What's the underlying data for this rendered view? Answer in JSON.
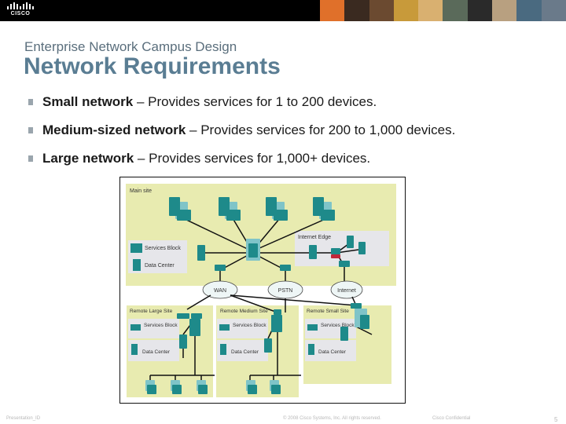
{
  "header": {
    "logo_text": "CISCO",
    "photo_strip_colors": [
      "#e0702a",
      "#3a2a20",
      "#6b4a30",
      "#c89a3a",
      "#d9b070",
      "#5a6a5a",
      "#2a2a2a",
      "#b8a080",
      "#4a6a80",
      "#6a7a8a"
    ]
  },
  "slide": {
    "subtitle": "Enterprise Network Campus Design",
    "title": "Network Requirements",
    "bullets": [
      {
        "bold": "Small network",
        "text": " – Provides services for 1 to 200 devices."
      },
      {
        "bold": "Medium-sized network",
        "text": " – Provides services for 200 to 1,000 devices."
      },
      {
        "bold": "Large network",
        "text": " – Provides services for 1,000+ devices."
      }
    ]
  },
  "diagram": {
    "main_site_label": "Main site",
    "internet_edge_label": "Internet Edge",
    "services_block_label": "Services Block",
    "data_center_label": "Data Center",
    "clouds": [
      "WAN",
      "PSTN",
      "Internet"
    ],
    "remote_large_label": "Remote Large Site",
    "remote_medium_label": "Remote Medium Site",
    "remote_small_label": "Remote Small Site",
    "services_block_short": "Services Block",
    "data_center_short": "Data Center",
    "colors": {
      "site_bg": "#e8ebb0",
      "block_bg": "#e6e6ea",
      "device": "#1e8a8a",
      "device_light": "#7fc4c8",
      "link": "#111111",
      "firewall": "#c0283a"
    }
  },
  "footer": {
    "presentation_id": "Presentation_ID",
    "copyright": "© 2008 Cisco Systems, Inc. All rights reserved.",
    "confidential": "Cisco Confidential",
    "page_number": "5"
  }
}
